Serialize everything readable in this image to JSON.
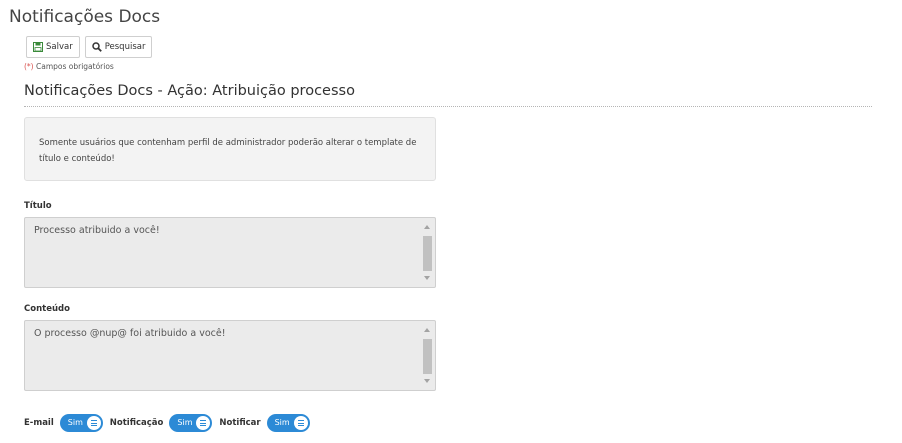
{
  "page": {
    "title": "Notificações Docs"
  },
  "toolbar": {
    "save_label": "Salvar",
    "search_label": "Pesquisar",
    "save_icon": "floppy-disk-icon",
    "search_icon": "magnifier-icon"
  },
  "required_note": {
    "star": "(*)",
    "text": " Campos obrigatórios"
  },
  "section": {
    "title": "Notificações Docs - Ação: Atribuição processo"
  },
  "info": {
    "text": "Somente usuários que contenham perfil de administrador poderão alterar o template de título e conteúdo!"
  },
  "fields": {
    "titulo": {
      "label": "Título",
      "value": "Processo atribuido a você!"
    },
    "conteudo": {
      "label": "Conteúdo",
      "value": "O processo @nup@ foi atribuido a você!"
    }
  },
  "toggles": [
    {
      "label": "E-mail",
      "state": "Sim"
    },
    {
      "label": "Notificação",
      "state": "Sim"
    },
    {
      "label": "Notificar",
      "state": "Sim"
    }
  ],
  "colors": {
    "accent": "#2c8ad6",
    "required_star": "#d9534f"
  }
}
